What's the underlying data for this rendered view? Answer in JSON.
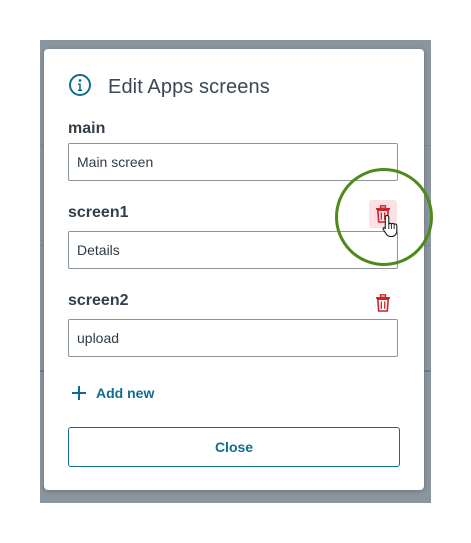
{
  "dialog": {
    "title": "Edit Apps screens",
    "info_icon": "info-circle-icon"
  },
  "screens": [
    {
      "label": "main",
      "value": "Main screen",
      "deletable": false
    },
    {
      "label": "screen1",
      "value": "Details",
      "deletable": true,
      "hovered": true
    },
    {
      "label": "screen2",
      "value": "upload",
      "deletable": true
    }
  ],
  "actions": {
    "add_new_label": "Add new",
    "close_label": "Close"
  },
  "icons": {
    "delete": "trash-icon",
    "add": "plus-icon",
    "cursor": "hand-pointer-icon"
  },
  "colors": {
    "accent": "#0f6e8c",
    "delete": "#c8252c",
    "delete_hover_bg": "#fbe1e1",
    "highlight_ring": "#4e8a1b",
    "backdrop": "#8a959e"
  }
}
